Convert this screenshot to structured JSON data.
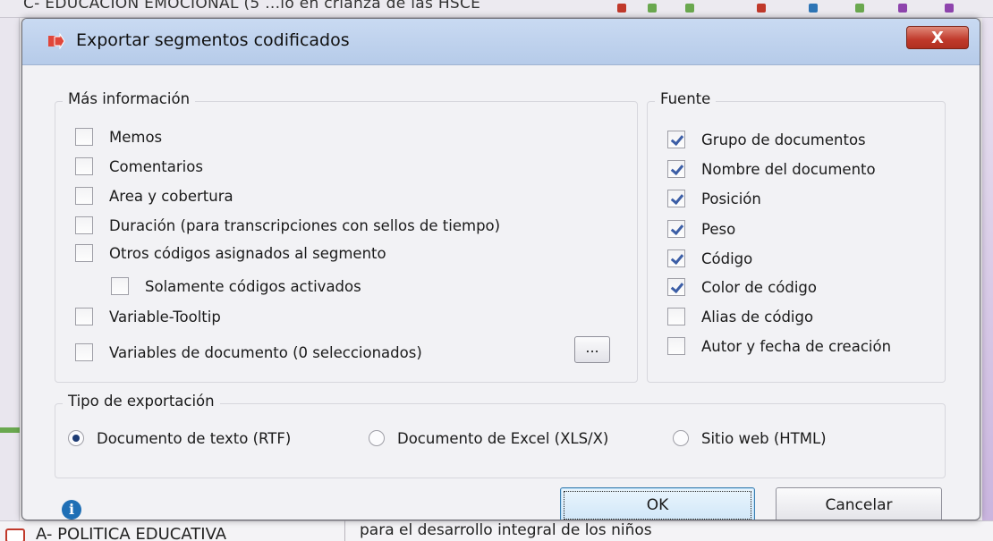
{
  "background": {
    "top_text": "C- EDUCACIÓN EMOCIONAL (5 ...lo en crianza de las HSCE",
    "bottom_left_text": "A- POLITICA EDUCATIVA",
    "bottom_right_text": "para el desarrollo integral de los niños",
    "dot_colors": [
      "#c0392b",
      "#6aa84f",
      "#6aa84f",
      "#c0392b",
      "#2e75b6",
      "#6aa84f",
      "#8e44ad",
      "#8e44ad"
    ]
  },
  "dialog": {
    "title": "Exportar segmentos codificados",
    "close_symbol": "X",
    "more_info": {
      "legend": "Más información",
      "items": [
        {
          "label": "Memos",
          "checked": false
        },
        {
          "label": "Comentarios",
          "checked": false
        },
        {
          "label": "Area y cobertura",
          "checked": false
        },
        {
          "label": "Duración (para transcripciones con sellos de tiempo)",
          "checked": false
        },
        {
          "label": "Otros códigos asignados al segmento",
          "checked": false
        },
        {
          "label": "Solamente códigos activados",
          "checked": false
        },
        {
          "label": "Variable-Tooltip",
          "checked": false
        },
        {
          "label": "Variables de documento (0 seleccionados)",
          "checked": false
        }
      ],
      "browse_label": "..."
    },
    "source": {
      "legend": "Fuente",
      "items": [
        {
          "label": "Grupo de documentos",
          "checked": true
        },
        {
          "label": "Nombre del documento",
          "checked": true
        },
        {
          "label": "Posición",
          "checked": true
        },
        {
          "label": "Peso",
          "checked": true
        },
        {
          "label": "Código",
          "checked": true
        },
        {
          "label": "Color de código",
          "checked": true
        },
        {
          "label": "Alias de código",
          "checked": false
        },
        {
          "label": "Autor y fecha de creación",
          "checked": false
        }
      ]
    },
    "export_type": {
      "legend": "Tipo de exportación",
      "options": [
        {
          "label": "Documento de texto (RTF)",
          "selected": true
        },
        {
          "label": "Documento de Excel (XLS/X)",
          "selected": false
        },
        {
          "label": "Sitio web (HTML)",
          "selected": false
        }
      ]
    },
    "info_symbol": "i",
    "ok_label": "OK",
    "cancel_label": "Cancelar"
  }
}
